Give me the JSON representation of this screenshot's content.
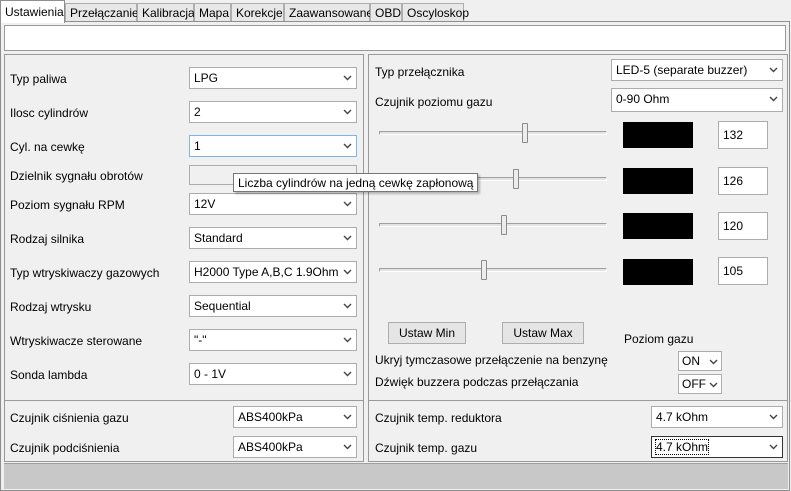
{
  "tabs": [
    "Ustawienia",
    "Przełączanie",
    "Kalibracja",
    "Mapa",
    "Korekcje",
    "Zaawansowane",
    "OBD",
    "Oscyloskop"
  ],
  "left": {
    "rows": [
      {
        "label": "Typ paliwa",
        "value": "LPG"
      },
      {
        "label": "Ilosc cylindrów",
        "value": "2"
      },
      {
        "label": "Cyl. na cewkę",
        "value": "1"
      },
      {
        "label": "Dzielnik sygnału obrotów",
        "value": ""
      },
      {
        "label": "Poziom sygnału RPM",
        "value": "12V"
      },
      {
        "label": "Rodzaj silnika",
        "value": "Standard"
      },
      {
        "label": "Typ wtryskiwaczy gazowych",
        "value": "H2000 Type A,B,C 1.9Ohm"
      },
      {
        "label": "Rodzaj wtrysku",
        "value": "Sequential"
      },
      {
        "label": "Wtryskiwacze sterowane",
        "value": "\"-\""
      },
      {
        "label": "Sonda lambda",
        "value": "0 - 1V"
      }
    ]
  },
  "right": {
    "switch_type_label": "Typ przełącznika",
    "switch_type_value": "LED-5 (separate buzzer)",
    "gas_sensor_label": "Czujnik poziomu gazu",
    "gas_sensor_value": "0-90 Ohm",
    "sliders": [
      {
        "value": "132",
        "level": 0.64
      },
      {
        "value": "126",
        "level": 0.6
      },
      {
        "value": "120",
        "level": 0.55
      },
      {
        "value": "105",
        "level": 0.46
      }
    ],
    "btn_min": "Ustaw Min",
    "btn_max": "Ustaw Max",
    "gas_level_label": "Poziom gazu",
    "hide_label": "Ukryj tymczasowe przełączenie na benzynę",
    "hide_value": "ON",
    "buzzer_label": "Dźwięk buzzera podczas przełączania",
    "buzzer_value": "OFF"
  },
  "bottom_left": {
    "rows": [
      {
        "label": "Czujnik ciśnienia gazu",
        "value": "ABS400kPa"
      },
      {
        "label": "Czujnik podciśnienia",
        "value": "ABS400kPa"
      }
    ]
  },
  "bottom_right": {
    "rows": [
      {
        "label": "Czujnik temp. reduktora",
        "value": "4.7 kOhm"
      },
      {
        "label": "Czujnik temp. gazu",
        "value": "4.7 kOhm"
      }
    ]
  },
  "tooltip": "Liczba cylindrów na jedną cewkę zapłonową"
}
